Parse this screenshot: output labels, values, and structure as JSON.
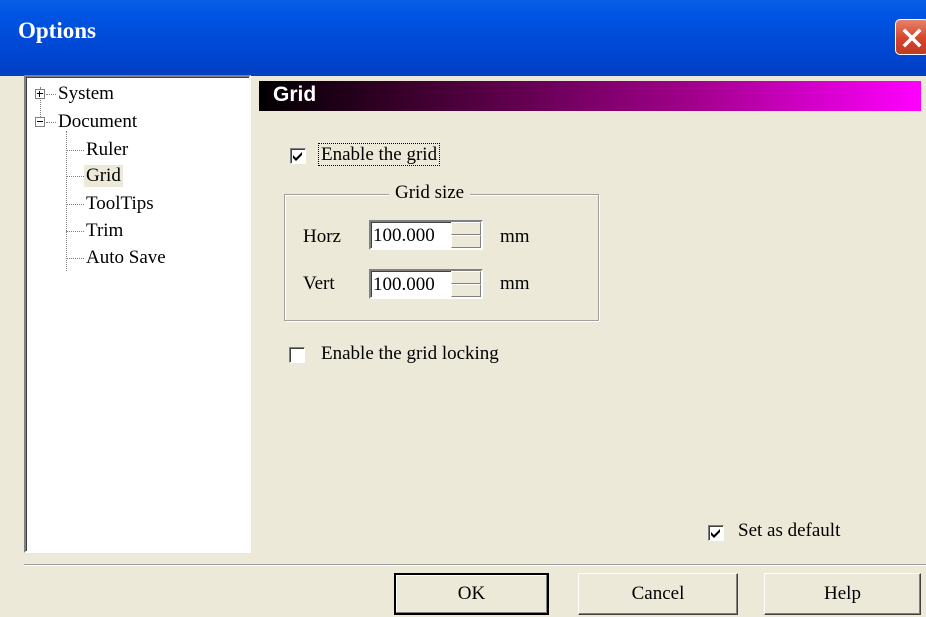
{
  "window": {
    "title": "Options",
    "close_icon": "close-icon"
  },
  "tree": {
    "items": [
      {
        "label": "System",
        "expander": "plus"
      },
      {
        "label": "Document",
        "expander": "minus"
      },
      {
        "label": "Ruler"
      },
      {
        "label": "Grid",
        "selected": true
      },
      {
        "label": "ToolTips"
      },
      {
        "label": "Trim"
      },
      {
        "label": "Auto Save"
      }
    ]
  },
  "panel": {
    "header": "Grid",
    "enable_grid": {
      "label": "Enable the grid",
      "checked": true
    },
    "grid_size": {
      "title": "Grid size",
      "horz": {
        "label": "Horz",
        "value": "100.000",
        "unit": "mm"
      },
      "vert": {
        "label": "Vert",
        "value": "100.000",
        "unit": "mm"
      }
    },
    "enable_locking": {
      "label": "Enable the grid locking",
      "checked": false
    },
    "set_default": {
      "label": "Set as default",
      "checked": true
    }
  },
  "buttons": {
    "ok": "OK",
    "cancel": "Cancel",
    "help": "Help"
  },
  "colors": {
    "title_bar": "#0054e3",
    "header_gradient_end": "#ff00ff",
    "dialog_bg": "#ece9d8"
  }
}
